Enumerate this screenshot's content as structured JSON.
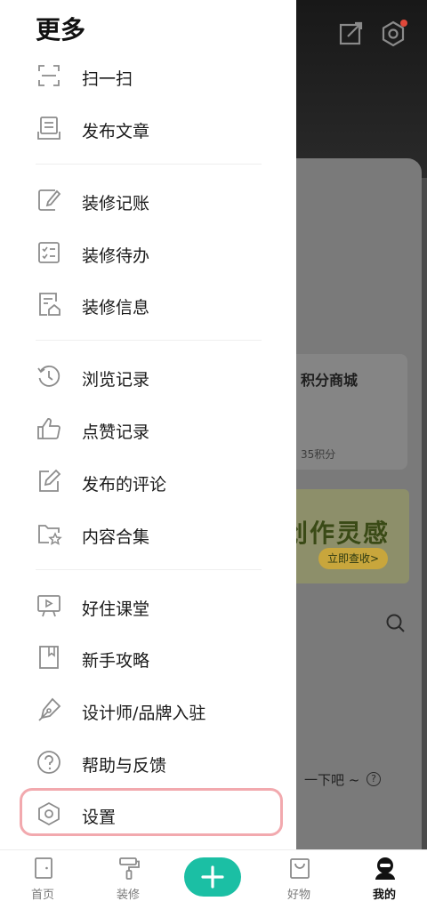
{
  "drawer": {
    "title": "更多",
    "items": [
      {
        "label": "扫一扫",
        "icon": "scan-icon"
      },
      {
        "label": "发布文章",
        "icon": "publish-article-icon"
      },
      {
        "label": "装修记账",
        "icon": "notebook-pen-icon"
      },
      {
        "label": "装修待办",
        "icon": "checklist-icon"
      },
      {
        "label": "装修信息",
        "icon": "house-document-icon"
      },
      {
        "label": "浏览记录",
        "icon": "history-icon"
      },
      {
        "label": "点赞记录",
        "icon": "thumbs-up-icon"
      },
      {
        "label": "发布的评论",
        "icon": "edit-comment-icon"
      },
      {
        "label": "内容合集",
        "icon": "folder-star-icon"
      },
      {
        "label": "好住课堂",
        "icon": "video-board-icon"
      },
      {
        "label": "新手攻略",
        "icon": "bookmark-book-icon"
      },
      {
        "label": "设计师/品牌入驻",
        "icon": "pen-nib-icon"
      },
      {
        "label": "帮助与反馈",
        "icon": "help-circle-icon"
      },
      {
        "label": "设置",
        "icon": "hexagon-settings-icon"
      }
    ]
  },
  "background": {
    "card_title": "积分商城",
    "card_sub": "35积分",
    "banner_title": "创作灵感",
    "banner_button": "立即查收>",
    "hint": "一下吧 ~",
    "hint_q": "?"
  },
  "tabbar": {
    "tabs": [
      {
        "label": "首页",
        "icon": "home-door-icon"
      },
      {
        "label": "装修",
        "icon": "paint-roller-icon"
      },
      {
        "label": "",
        "icon": "plus-icon"
      },
      {
        "label": "好物",
        "icon": "shopping-bag-icon"
      },
      {
        "label": "我的",
        "icon": "user-avatar-icon"
      }
    ],
    "active_tab": "我的"
  },
  "colors": {
    "accent": "#1bbfa4",
    "settings_highlight": "#f2a9ae",
    "overlay": "#4a4a4a"
  }
}
